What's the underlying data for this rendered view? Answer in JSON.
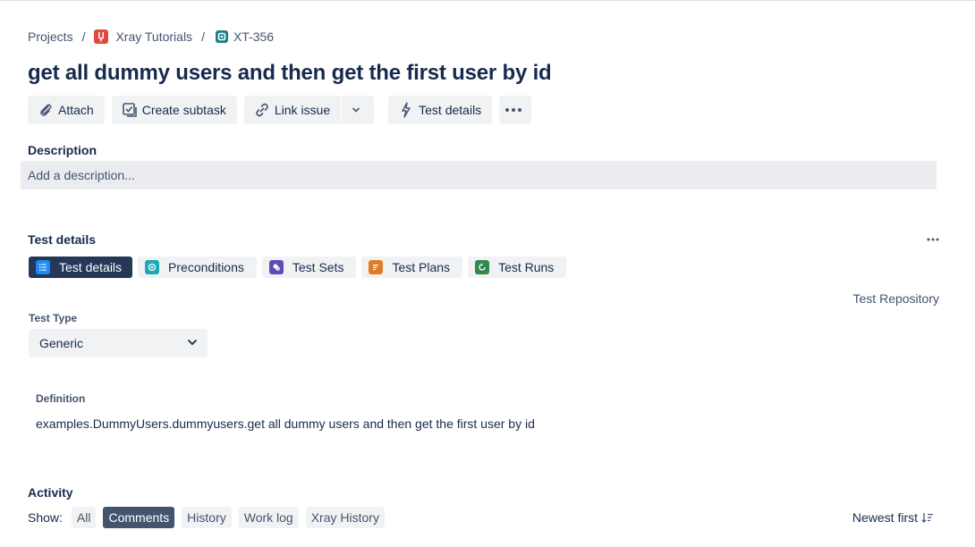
{
  "breadcrumb": {
    "projects": "Projects",
    "separator": "/",
    "project_name": "Xray Tutorials",
    "issue_key": "XT-356"
  },
  "title": "get all dummy users and then get the first user by id",
  "toolbar": {
    "attach": "Attach",
    "create_subtask": "Create subtask",
    "link_issue": "Link issue",
    "test_details": "Test details"
  },
  "description": {
    "label": "Description",
    "placeholder": "Add a description..."
  },
  "test_details": {
    "heading": "Test details",
    "tabs": [
      {
        "label": "Test details",
        "icon": "list-icon",
        "color": "#1d8bf1",
        "active": true
      },
      {
        "label": "Preconditions",
        "icon": "preconditions-icon",
        "color": "#1fa9b6"
      },
      {
        "label": "Test Sets",
        "icon": "test-sets-icon",
        "color": "#5e4db2"
      },
      {
        "label": "Test Plans",
        "icon": "test-plans-icon",
        "color": "#e07b29"
      },
      {
        "label": "Test Runs",
        "icon": "test-runs-icon",
        "color": "#2f8a4e"
      }
    ],
    "repository_link": "Test Repository",
    "test_type_label": "Test Type",
    "test_type_value": "Generic",
    "definition_label": "Definition",
    "definition_value": "examples.DummyUsers.dummyusers.get all dummy users and then get the first user by id"
  },
  "activity": {
    "heading": "Activity",
    "show_label": "Show:",
    "filters": [
      "All",
      "Comments",
      "History",
      "Work log",
      "Xray History"
    ],
    "active_filter": "Comments",
    "sort_label": "Newest first"
  },
  "colors": {
    "text_primary": "#172b4d",
    "text_subtle": "#44546f",
    "button_bg": "#f1f2f4",
    "active_tab_bg": "#253858",
    "active_filter_bg": "#44546f",
    "project_avatar": "#e2483d",
    "issue_type": "#1d7f8c"
  }
}
